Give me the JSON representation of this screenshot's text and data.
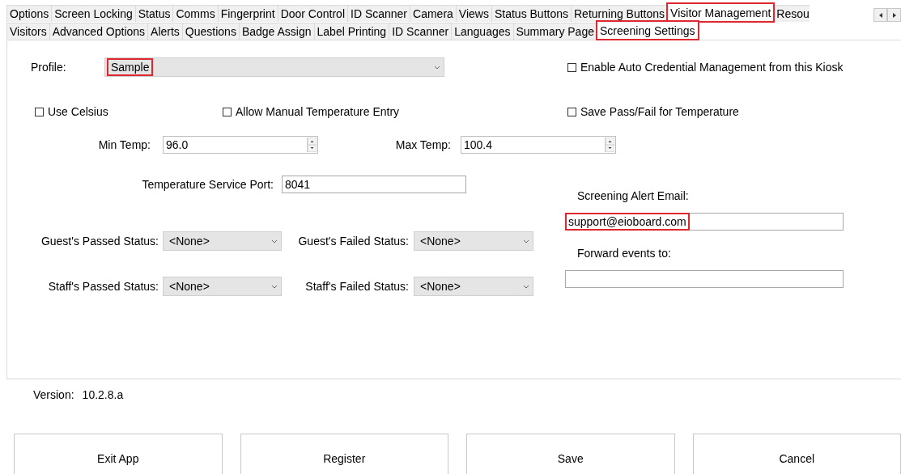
{
  "tabs": [
    {
      "label": "Options",
      "selected": false,
      "highlighted": false
    },
    {
      "label": "Screen Locking",
      "selected": false,
      "highlighted": false
    },
    {
      "label": "Status",
      "selected": false,
      "highlighted": false
    },
    {
      "label": "Comms",
      "selected": false,
      "highlighted": false
    },
    {
      "label": "Fingerprint",
      "selected": false,
      "highlighted": false
    },
    {
      "label": "Door Control",
      "selected": false,
      "highlighted": false
    },
    {
      "label": "ID Scanner",
      "selected": false,
      "highlighted": false
    },
    {
      "label": "Camera",
      "selected": false,
      "highlighted": false
    },
    {
      "label": "Views",
      "selected": false,
      "highlighted": false
    },
    {
      "label": "Status Buttons",
      "selected": false,
      "highlighted": false
    },
    {
      "label": "Returning Buttons",
      "selected": false,
      "highlighted": false
    },
    {
      "label": "Visitor Management",
      "selected": true,
      "highlighted": true
    },
    {
      "label": "Resou",
      "selected": false,
      "highlighted": false
    }
  ],
  "subtabs": [
    {
      "label": "Visitors",
      "selected": false,
      "highlighted": false
    },
    {
      "label": "Advanced Options",
      "selected": false,
      "highlighted": false
    },
    {
      "label": "Alerts",
      "selected": false,
      "highlighted": false
    },
    {
      "label": "Questions",
      "selected": false,
      "highlighted": false
    },
    {
      "label": "Badge Assign",
      "selected": false,
      "highlighted": false
    },
    {
      "label": "Label Printing",
      "selected": false,
      "highlighted": false
    },
    {
      "label": "ID Scanner",
      "selected": false,
      "highlighted": false
    },
    {
      "label": "Languages",
      "selected": false,
      "highlighted": false
    },
    {
      "label": "Summary Page",
      "selected": false,
      "highlighted": false
    },
    {
      "label": "Screening Settings",
      "selected": true,
      "highlighted": true
    }
  ],
  "form": {
    "profile": {
      "label": "Profile:",
      "value": "Sample",
      "highlighted": true
    },
    "auto_credential": {
      "label": "Enable Auto Credential Management from this Kiosk",
      "checked": false
    },
    "checkboxes": [
      {
        "label": "Use Celsius",
        "checked": false
      },
      {
        "label": "Allow Manual Temperature Entry",
        "checked": false
      },
      {
        "label": "Save Pass/Fail for Temperature",
        "checked": false
      }
    ],
    "min_temp": {
      "label": "Min Temp:",
      "value": "96.0"
    },
    "max_temp": {
      "label": "Max Temp:",
      "value": "100.4"
    },
    "service_port": {
      "label": "Temperature Service Port:",
      "value": "8041"
    },
    "alert_email": {
      "label": "Screening Alert Email:",
      "value": "support@eioboard.com",
      "highlighted": true
    },
    "forward_events": {
      "label": "Forward events to:"
    },
    "statuses": [
      {
        "label": "Guest's Passed Status:",
        "value": "<None>"
      },
      {
        "label": "Guest's Failed Status:",
        "value": "<None>"
      },
      {
        "label": "Staff's Passed Status:",
        "value": "<None>"
      },
      {
        "label": "Staff's Failed Status:",
        "value": "<None>"
      }
    ]
  },
  "version": {
    "label": "Version:",
    "value": "10.2.8.a"
  },
  "buttons": [
    "Exit App",
    "Register",
    "Save",
    "Cancel"
  ]
}
